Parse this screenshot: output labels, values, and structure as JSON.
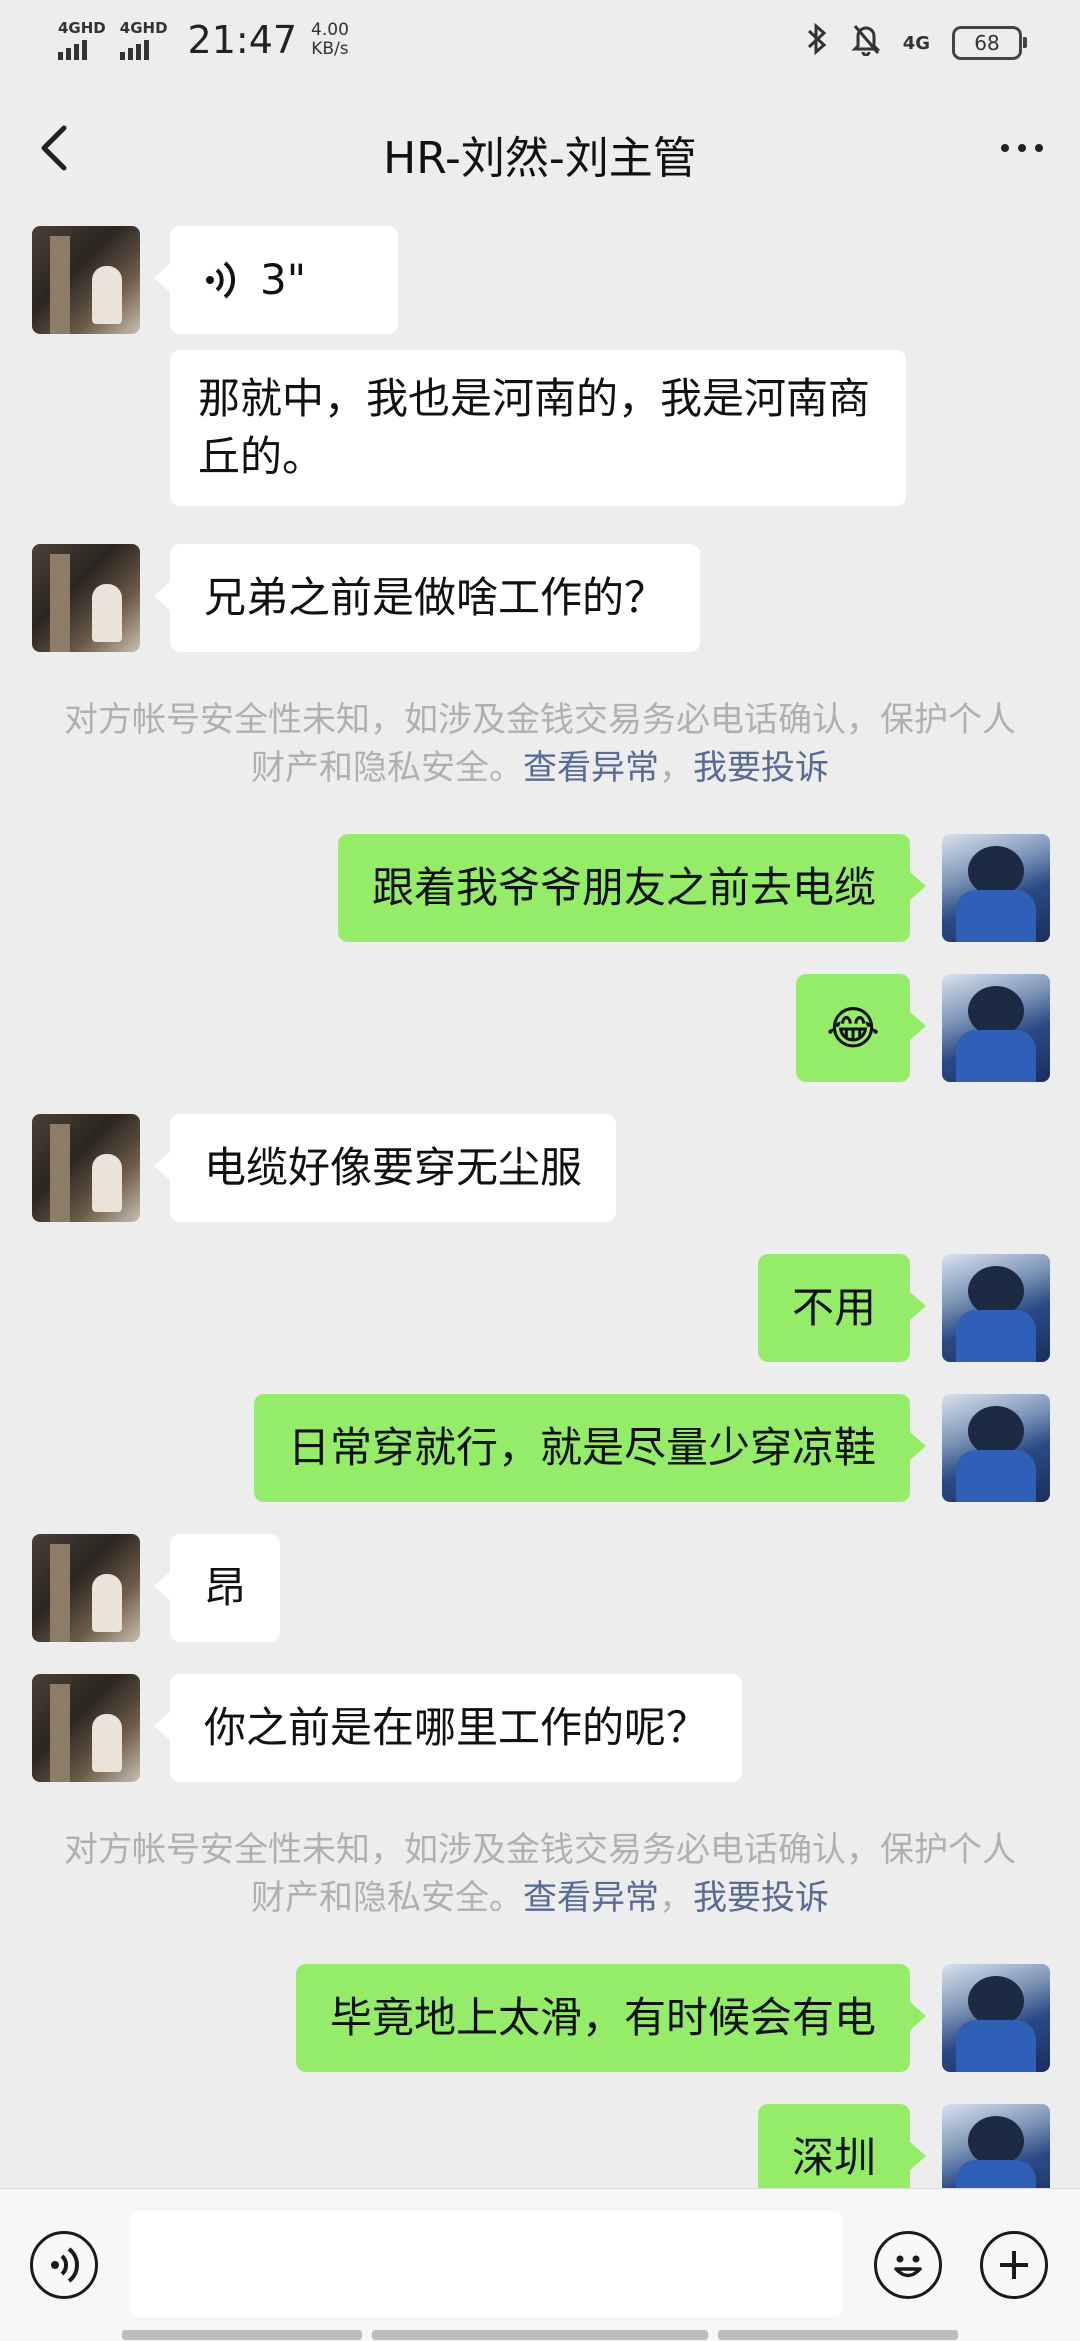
{
  "status_bar": {
    "sim1": "4GHD",
    "sim2": "4GHD",
    "time": "21:47",
    "net_speed_value": "4.00",
    "net_speed_unit": "KB/s",
    "icons": [
      "bluetooth-icon",
      "bell-off-icon",
      "4g-icon",
      "battery-icon"
    ],
    "net_type": "4G",
    "battery": "68"
  },
  "header": {
    "title": "HR-刘然-刘主管",
    "back_icon": "chevron-left-icon",
    "more_icon": "more-dots-icon"
  },
  "messages": [
    {
      "from": "them",
      "type": "voice",
      "duration": "3\""
    },
    {
      "from": "them",
      "type": "text",
      "text": "那就中，我也是河南的，我是河南商丘的。"
    },
    {
      "from": "them",
      "type": "text",
      "text": "兄弟之前是做啥工作的？"
    },
    {
      "type": "notice",
      "text": "对方帐号安全性未知，如涉及金钱交易务必电话确认，保护个人财产和隐私安全。",
      "link1": "查看异常",
      "sep": "，",
      "link2": "我要投诉"
    },
    {
      "from": "me",
      "type": "text",
      "text": "跟着我爷爷朋友之前去电缆"
    },
    {
      "from": "me",
      "type": "emoji",
      "text": "😂"
    },
    {
      "from": "them",
      "type": "text",
      "text": "电缆好像要穿无尘服"
    },
    {
      "from": "me",
      "type": "text",
      "text": "不用"
    },
    {
      "from": "me",
      "type": "text",
      "text": "日常穿就行，就是尽量少穿凉鞋"
    },
    {
      "from": "them",
      "type": "text",
      "text": "昂"
    },
    {
      "from": "them",
      "type": "text",
      "text": "你之前是在哪里工作的呢？"
    },
    {
      "type": "notice",
      "text": "对方帐号安全性未知，如涉及金钱交易务必电话确认，保护个人财产和隐私安全。",
      "link1": "查看异常",
      "sep": "，",
      "link2": "我要投诉"
    },
    {
      "from": "me",
      "type": "text",
      "text": "毕竟地上太滑，有时候会有电"
    },
    {
      "from": "me",
      "type": "text",
      "text": "深圳"
    }
  ],
  "input_bar": {
    "voice_icon": "voice-mode-icon",
    "input_value": "",
    "emoji_icon": "emoji-smile-icon",
    "plus_icon": "plus-icon"
  },
  "colors": {
    "background": "#ededed",
    "my_bubble": "#95ec69",
    "their_bubble": "#ffffff",
    "notice_link": "#576b95"
  }
}
